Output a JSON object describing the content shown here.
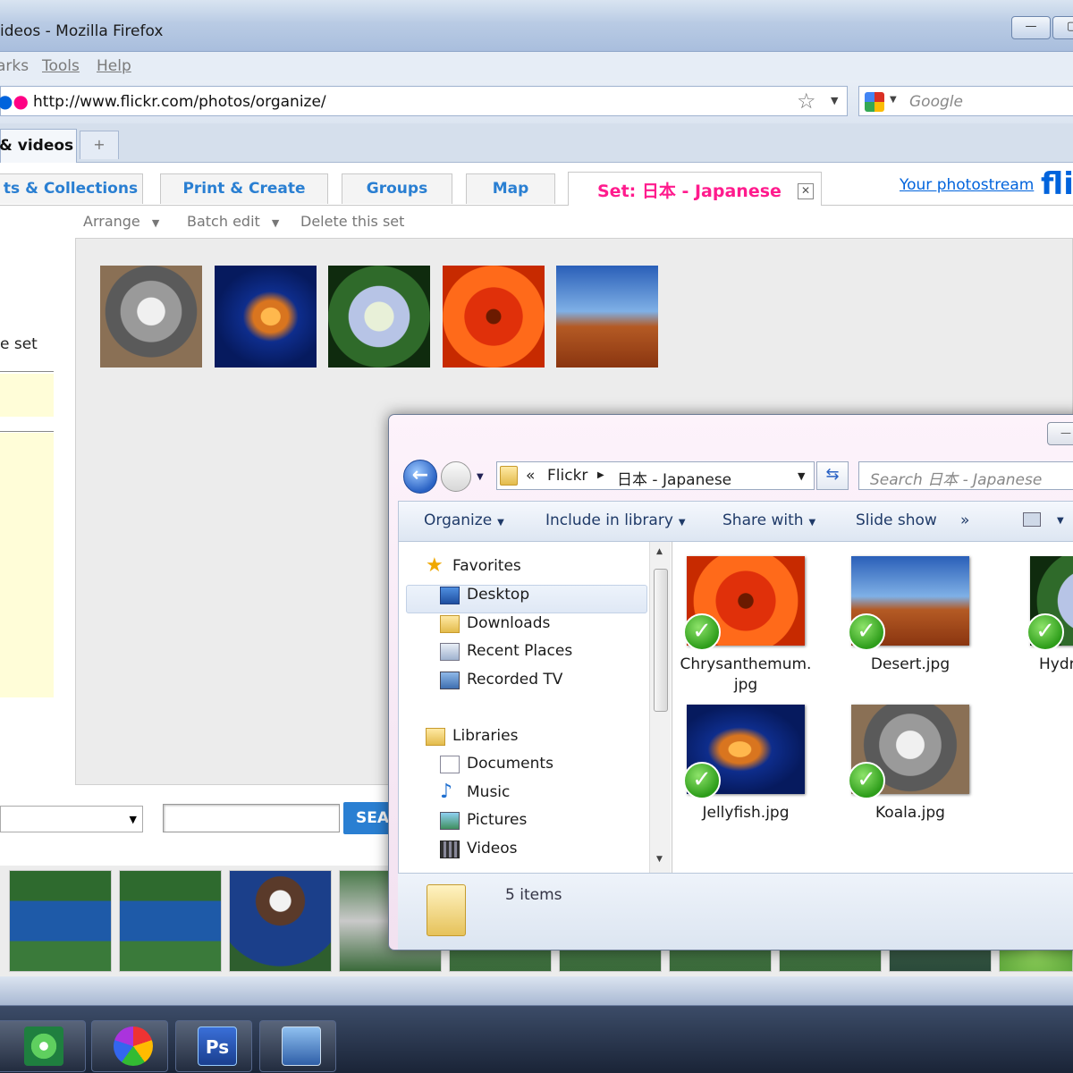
{
  "browser": {
    "title": "ideos - Mozilla Firefox",
    "menu": [
      "arks",
      "Tools",
      "Help"
    ],
    "url": "http://www.flickr.com/photos/organize/",
    "search_placeholder": "Google",
    "tab_label": "& videos",
    "new_tab": "+"
  },
  "flickr": {
    "tabs": [
      "ts & Collections",
      "Print & Create",
      "Groups",
      "Map"
    ],
    "active_tab": "Set: 日本 - Japanese",
    "photostream": "Your photostream",
    "logo": "fli",
    "subtoolbar": [
      "Arrange",
      "Batch edit",
      "Delete this set"
    ],
    "left_label": "e set",
    "search_button": "SEA"
  },
  "explorer": {
    "breadcrumb": [
      "«",
      "Flickr",
      "日本 - Japanese"
    ],
    "search_placeholder": "Search 日本 - Japanese",
    "commands": [
      "Organize",
      "Include in library",
      "Share with",
      "Slide show",
      "»"
    ],
    "nav": {
      "favorites": "Favorites",
      "favorites_items": [
        "Desktop",
        "Downloads",
        "Recent Places",
        "Recorded TV"
      ],
      "libraries": "Libraries",
      "libraries_items": [
        "Documents",
        "Music",
        "Pictures",
        "Videos"
      ]
    },
    "files": [
      {
        "name": "Chrysanthemum.\njpg"
      },
      {
        "name": "Desert.jpg"
      },
      {
        "name": "Hydra"
      },
      {
        "name": "Jellyfish.jpg"
      },
      {
        "name": "Koala.jpg"
      }
    ],
    "status": "5 items"
  },
  "taskbar": {
    "ps_label": "Ps"
  }
}
